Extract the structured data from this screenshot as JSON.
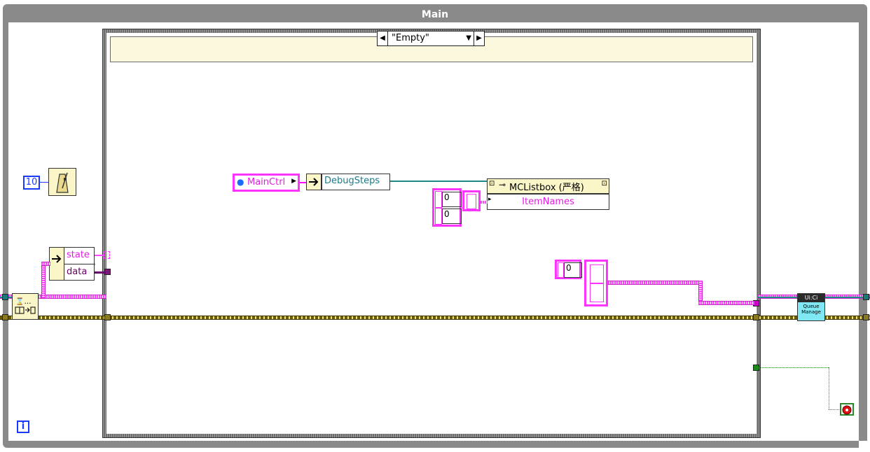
{
  "window": {
    "title": "Main"
  },
  "case_structure": {
    "selector_value": "\"Empty\""
  },
  "constants": {
    "wait_ms": "10",
    "array_index_1": "0",
    "array_index_2": "0",
    "array_index_3": "0"
  },
  "unbundle": {
    "items": [
      "state",
      "data"
    ]
  },
  "ref_node": {
    "label": "MainCtrl"
  },
  "property_debugsteps": {
    "label": "DebugSteps"
  },
  "property_listbox": {
    "class_label": "MCListbox (严格)",
    "property": "ItemNames"
  },
  "subvi_queue": {
    "header": "Ui:Ci",
    "body": "Queue Manage"
  },
  "loop_iteration": {
    "label": "i"
  },
  "colors": {
    "frame": "#8a8a8a",
    "case_header": "#fbf8dd",
    "string_wire": "#ff33ff",
    "error_wire": "#8a7a20",
    "ref_wire": "#1a8a8a",
    "bool_wire": "#2a8a2a"
  }
}
